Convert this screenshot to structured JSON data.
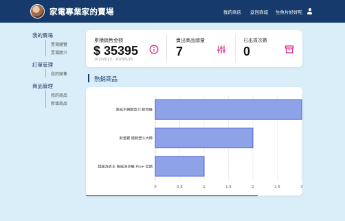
{
  "header": {
    "brand": "家電專業家的賣場",
    "nav": [
      "我的商店",
      "返回商城",
      "生魚片好好吃"
    ]
  },
  "sidebar": {
    "sections": [
      {
        "title": "我的賣場",
        "items": [
          "賣場總覽",
          "賣場簡介"
        ]
      },
      {
        "title": "訂單管理",
        "items": [
          "我的銷售"
        ]
      },
      {
        "title": "商品管理",
        "items": [
          "我的商品",
          "新增商品"
        ]
      }
    ]
  },
  "stats": [
    {
      "label": "累積銷售金額",
      "value": "$ 35395",
      "sub": "2023/5/23 - 2023/5/25",
      "icon": "info-circle-icon"
    },
    {
      "label": "賣出商品總量",
      "value": "7",
      "icon": "sliders-icon"
    },
    {
      "label": "已出貨次數",
      "value": "0",
      "icon": "archive-box-icon"
    }
  ],
  "section_title": "熱銷商品",
  "colors": {
    "header": "#163a6b",
    "accent": "#e0218a",
    "bar_fill": "#8ea2e8",
    "bar_stroke": "#4a5fd0",
    "background": "#daeefa"
  },
  "chart_data": {
    "type": "bar",
    "orientation": "horizontal",
    "categories": [
      "美威不銹鋼菜刀 斬骨推",
      "默善寶 極致塑斗大師",
      "超級洗衣王 智能洗衣機 Pro+ 促銷"
    ],
    "values": [
      3,
      2,
      1
    ],
    "xlim": [
      0,
      3
    ],
    "xticks": [
      "0",
      "0.5",
      "1",
      "1.5",
      "2",
      "2.5",
      "3"
    ],
    "grid": true
  }
}
